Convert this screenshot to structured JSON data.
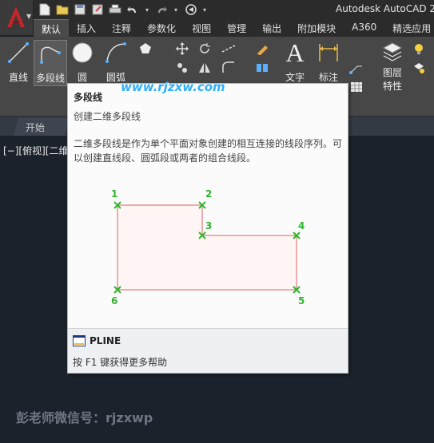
{
  "title_bar": {
    "title": "Autodesk AutoCAD 2"
  },
  "tabs": [
    "默认",
    "插入",
    "注释",
    "参数化",
    "视图",
    "管理",
    "输出",
    "附加模块",
    "A360",
    "精选应用"
  ],
  "ribbon": {
    "line_label": "直线",
    "polyline_label": "多段线",
    "circle_label": "圆",
    "arc_label": "圆弧",
    "text_label": "文字",
    "dimension_label": "标注",
    "layer_props_label_1": "图层",
    "layer_props_label_2": "特性"
  },
  "file_tab": {
    "label": "开始"
  },
  "viewport": {
    "label": "[−][俯视][二维线"
  },
  "watermarks": {
    "top": "www.rjzxw.com",
    "bottom": "彭老师微信号：rjzxwp"
  },
  "tooltip": {
    "title": "多段线",
    "subtitle": "创建二维多段线",
    "description": "二维多段线是作为单个平面对象创建的相互连接的线段序列。可以创建直线段、圆弧段或两者的组合线段。",
    "points": [
      "1",
      "2",
      "3",
      "4",
      "5",
      "6"
    ],
    "command": "PLINE",
    "help": "按 F1 键获得更多帮助"
  },
  "colors": {
    "accent_red": "#c0272d",
    "point_green": "#2fb52f",
    "polyline_red": "#e06060",
    "watermark_blue": "#2db0ff"
  },
  "icons": [
    "autocad-logo-icon",
    "new-icon",
    "open-icon",
    "save-icon",
    "save-as-icon",
    "print-icon",
    "undo-icon",
    "redo-icon",
    "share-icon"
  ]
}
